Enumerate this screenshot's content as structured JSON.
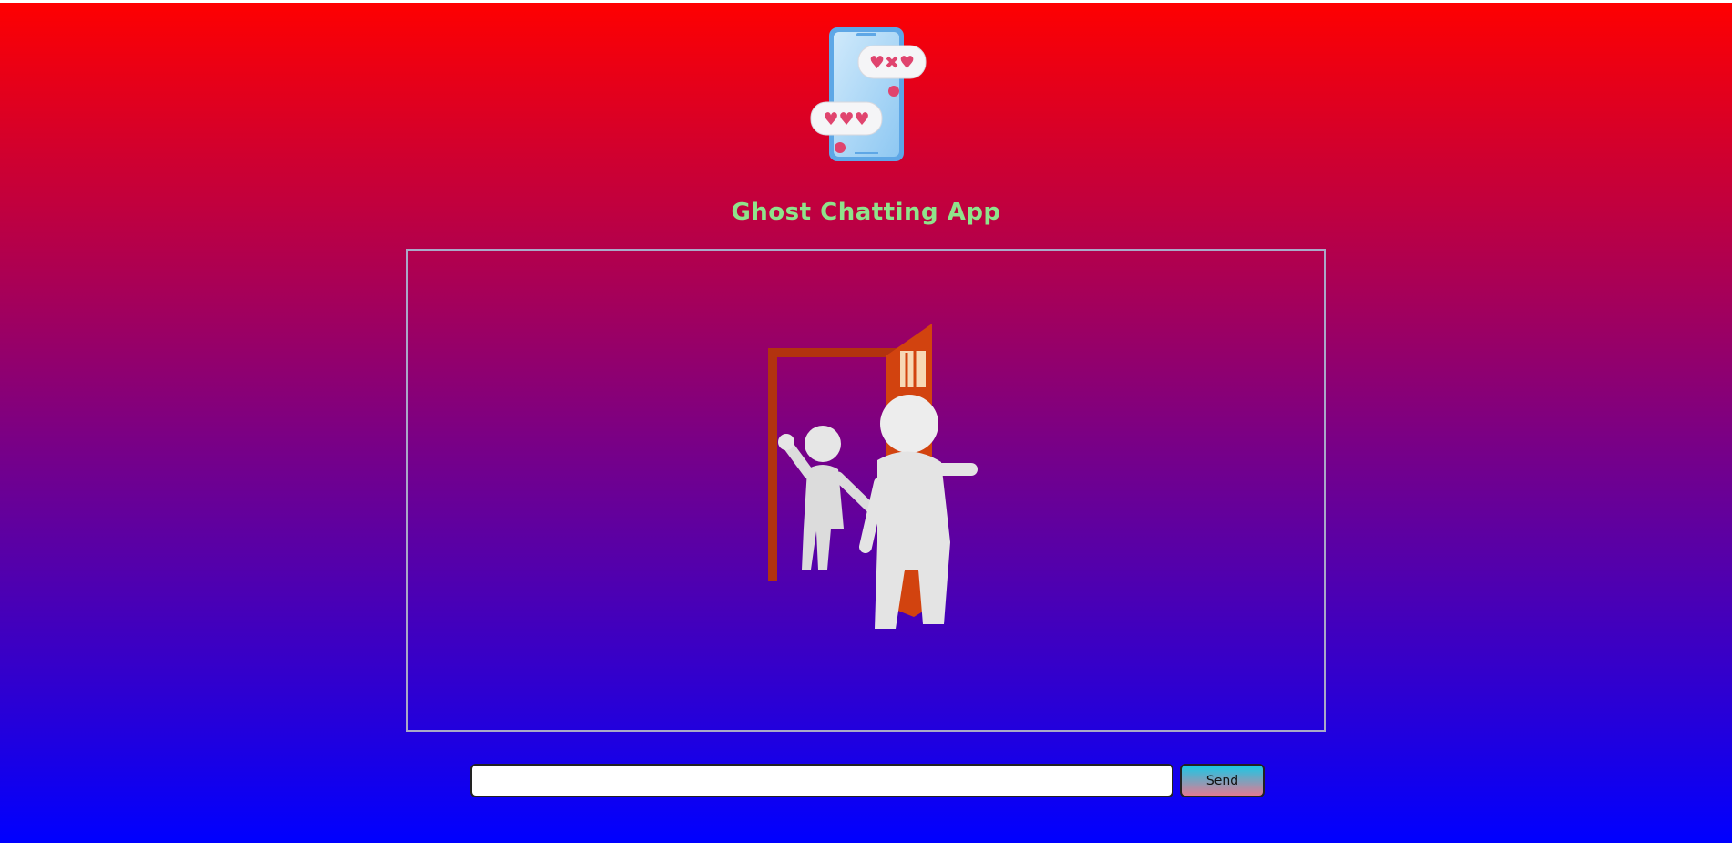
{
  "header": {
    "logo_icon": "phone-with-heart-messages-icon",
    "title": "Ghost Chatting App"
  },
  "chat": {
    "empty_state_illustration": "figure-waving-at-open-door-illustration"
  },
  "composer": {
    "input_value": "",
    "input_placeholder": "",
    "send_label": "Send"
  },
  "colors": {
    "background_top": "#ff0000",
    "background_bottom": "#0000ff",
    "title": "#8fe38b",
    "send_gradient_top": "#18c9e6",
    "send_gradient_bottom": "#e27a93"
  }
}
